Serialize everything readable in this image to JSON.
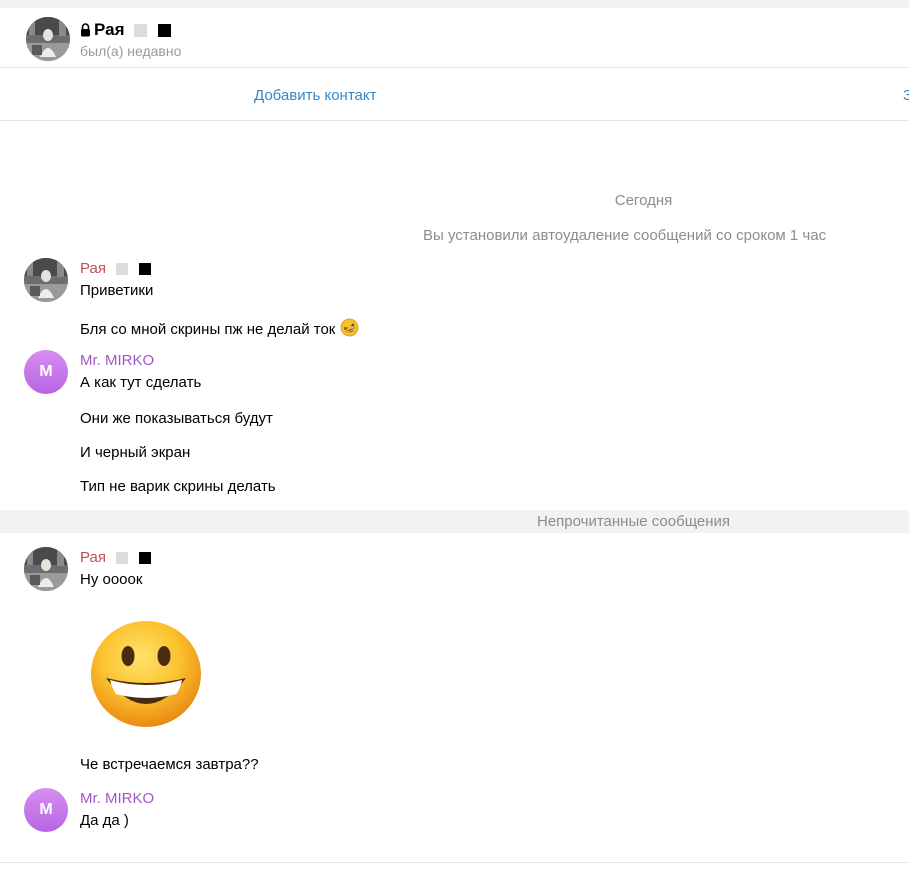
{
  "header": {
    "name": "Рая",
    "status": "был(а) недавно",
    "lock_icon": "lock-icon"
  },
  "contact_bar": {
    "add_contact": "Добавить контакт",
    "edge_mark": "З"
  },
  "service": {
    "date": "Сегодня",
    "autodelete": "Вы установили автоудаление сообщений со сроком 1 час",
    "unread": "Непрочитанные сообщения"
  },
  "senders": {
    "raya": "Рая",
    "mirko": "Mr. MIRKO",
    "mirko_initial": "M"
  },
  "messages": {
    "m1": "Приветики",
    "m2": "Бля со мной скрины пж не делай ток",
    "m3": "А как тут сделать",
    "m4": "Они же показываться будут",
    "m5": "И черный экран",
    "m6": "Тип не варик скрины делать",
    "m7": "Ну оооок",
    "m8": "Че встречаемся завтра??",
    "m9": "Да да )"
  },
  "emojis": {
    "inline": "rofl-emoji",
    "sticker": "grinning-face-emoji"
  },
  "colors": {
    "link": "#3a86c5",
    "raya_name": "#c0504d",
    "mirko_name": "#a158c6",
    "muted": "#8c8c8c"
  }
}
